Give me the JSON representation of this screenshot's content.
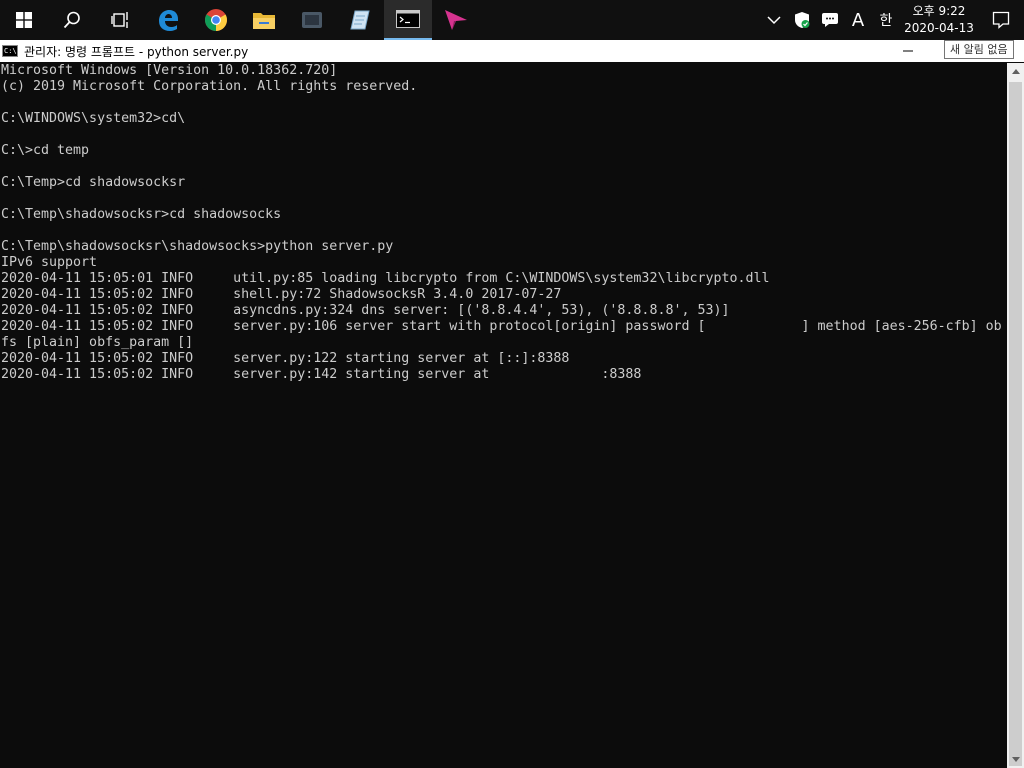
{
  "taskbar": {
    "apps": [
      {
        "name": "start",
        "icon": "windows-logo-icon"
      },
      {
        "name": "search",
        "icon": "search-icon"
      },
      {
        "name": "task-view",
        "icon": "task-view-icon"
      },
      {
        "name": "edge",
        "icon": "edge-icon"
      },
      {
        "name": "chrome",
        "icon": "chrome-icon"
      },
      {
        "name": "file-explorer",
        "icon": "folder-icon"
      },
      {
        "name": "app-dark",
        "icon": "dark-app-icon"
      },
      {
        "name": "app-notepad",
        "icon": "notepad-icon"
      },
      {
        "name": "command-prompt",
        "icon": "terminal-icon"
      },
      {
        "name": "app-arrow",
        "icon": "arrow-app-icon"
      }
    ],
    "tray": {
      "ime_mode": "A",
      "ime_lang": "한",
      "clock_time": "오후 9:22",
      "clock_date": "2020-04-13"
    },
    "accent_color": "#76b9ed"
  },
  "window": {
    "title": "관리자: 명령 프롬프트 - python  server.py",
    "tooltip": "새 알림 없음"
  },
  "console": {
    "lines": [
      "Microsoft Windows [Version 10.0.18362.720]",
      "(c) 2019 Microsoft Corporation. All rights reserved.",
      "",
      "C:\\WINDOWS\\system32>cd\\",
      "",
      "C:\\>cd temp",
      "",
      "C:\\Temp>cd shadowsocksr",
      "",
      "C:\\Temp\\shadowsocksr>cd shadowsocks",
      "",
      "C:\\Temp\\shadowsocksr\\shadowsocks>python server.py",
      "IPv6 support",
      "2020-04-11 15:05:01 INFO     util.py:85 loading libcrypto from C:\\WINDOWS\\system32\\libcrypto.dll",
      "2020-04-11 15:05:02 INFO     shell.py:72 ShadowsocksR 3.4.0 2017-07-27",
      "2020-04-11 15:05:02 INFO     asyncdns.py:324 dns server: [('8.8.4.4', 53), ('8.8.8.8', 53)]",
      "2020-04-11 15:05:02 INFO     server.py:106 server start with protocol[origin] password [            ] method [aes-256-cfb] ob",
      "fs [plain] obfs_param []",
      "2020-04-11 15:05:02 INFO     server.py:122 starting server at [::]:8388",
      "2020-04-11 15:05:02 INFO     server.py:142 starting server at              :8388"
    ],
    "text_color": "#cccccc",
    "background_color": "#0c0c0c"
  }
}
